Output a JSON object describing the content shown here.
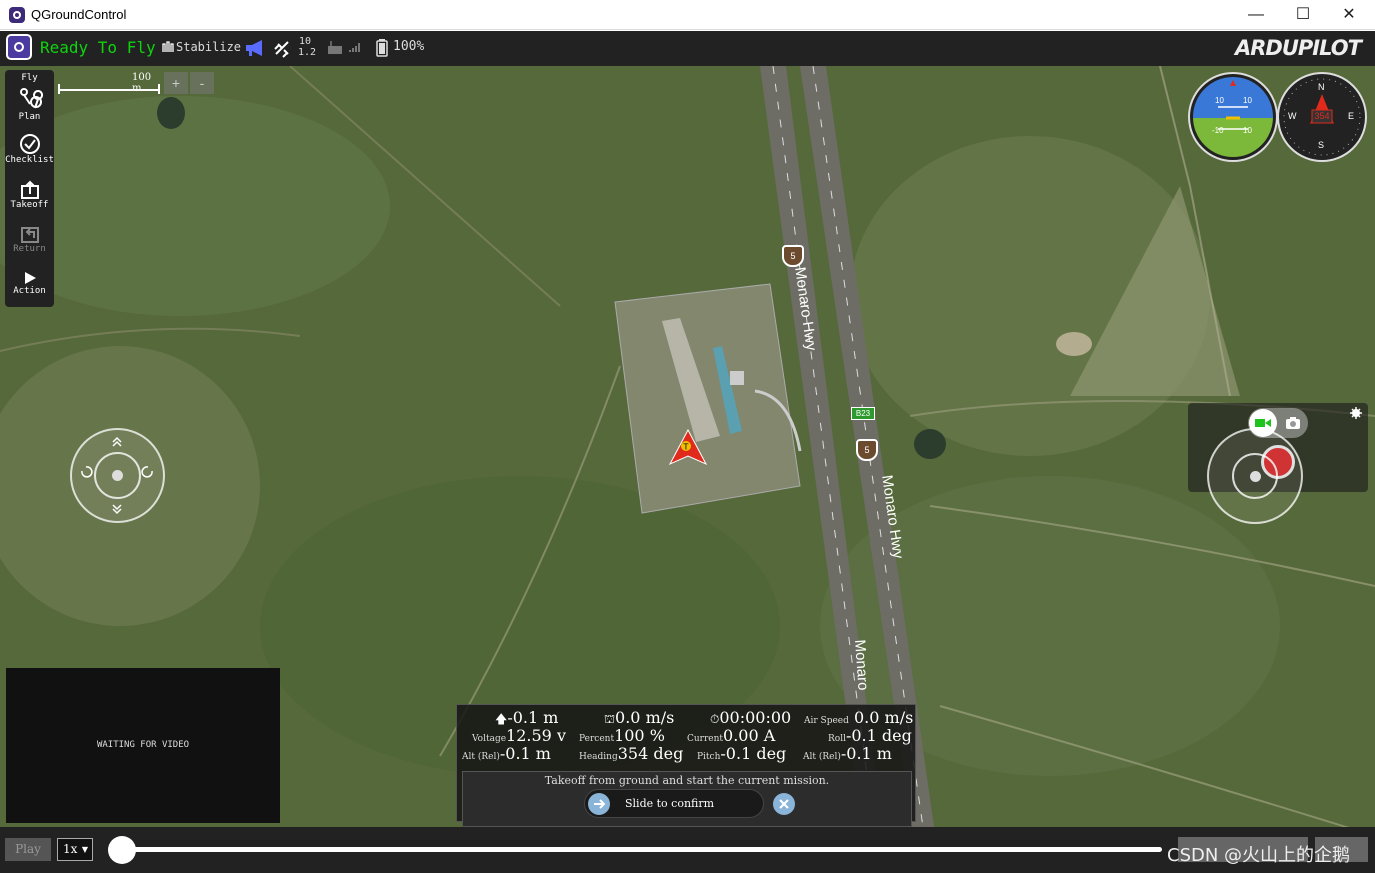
{
  "window": {
    "title": "QGroundControl",
    "minimize": "—",
    "maximize": "☐",
    "close": "✕"
  },
  "toolbar": {
    "status": "Ready To Fly",
    "flight_mode": "Stabilize",
    "gps_count": "10",
    "gps_hdop": "1.2",
    "battery": "100%",
    "brand": "ARDUPILOT"
  },
  "toolstrip": [
    {
      "label": "Fly",
      "icon": "fly-icon"
    },
    {
      "label": "Plan",
      "icon": "plan-icon"
    },
    {
      "label": "Checklist",
      "icon": "checklist-icon"
    },
    {
      "label": "Takeoff",
      "icon": "takeoff-icon"
    },
    {
      "label": "Return",
      "icon": "return-icon"
    },
    {
      "label": "Action",
      "icon": "action-icon"
    }
  ],
  "map": {
    "scale_label": "100 m",
    "zoom_in": "+",
    "zoom_out": "-",
    "road_labels": [
      "Monaro Hwy",
      "Monaro Hwy",
      "Monaro"
    ],
    "shield_5": "5",
    "shield_b23": "B23"
  },
  "compass": {
    "heading": "354",
    "n": "N",
    "s": "S",
    "e": "E",
    "w": "W"
  },
  "attitude": {
    "p10": "10",
    "m10": "-10"
  },
  "video": {
    "waiting": "WAITING FOR VIDEO"
  },
  "values": {
    "alt": "-0.1 m",
    "gspeed": "0.0 m/s",
    "time": "00:00:00",
    "airspeed_label": "Air Speed",
    "airspeed": "0.0 m/s",
    "voltage_label": "Voltage",
    "voltage": "12.59 v",
    "percent_label": "Percent",
    "percent": "100 %",
    "current_label": "Current",
    "current": "0.00 A",
    "roll_label": "Roll",
    "roll": "-0.1 deg",
    "altrel_label": "Alt (Rel)",
    "altrel": "-0.1 m",
    "heading_label": "Heading",
    "heading": "354 deg",
    "pitch_label": "Pitch",
    "pitch": "-0.1 deg",
    "altrel2_label": "Alt (Rel)",
    "altrel2": "-0.1 m"
  },
  "guided": {
    "message": "Takeoff from ground and start the current mission.",
    "slider": "Slide to confirm"
  },
  "bottom": {
    "play": "Play",
    "speed": "1x",
    "watermark": "CSDN @火山上的企鹅"
  }
}
